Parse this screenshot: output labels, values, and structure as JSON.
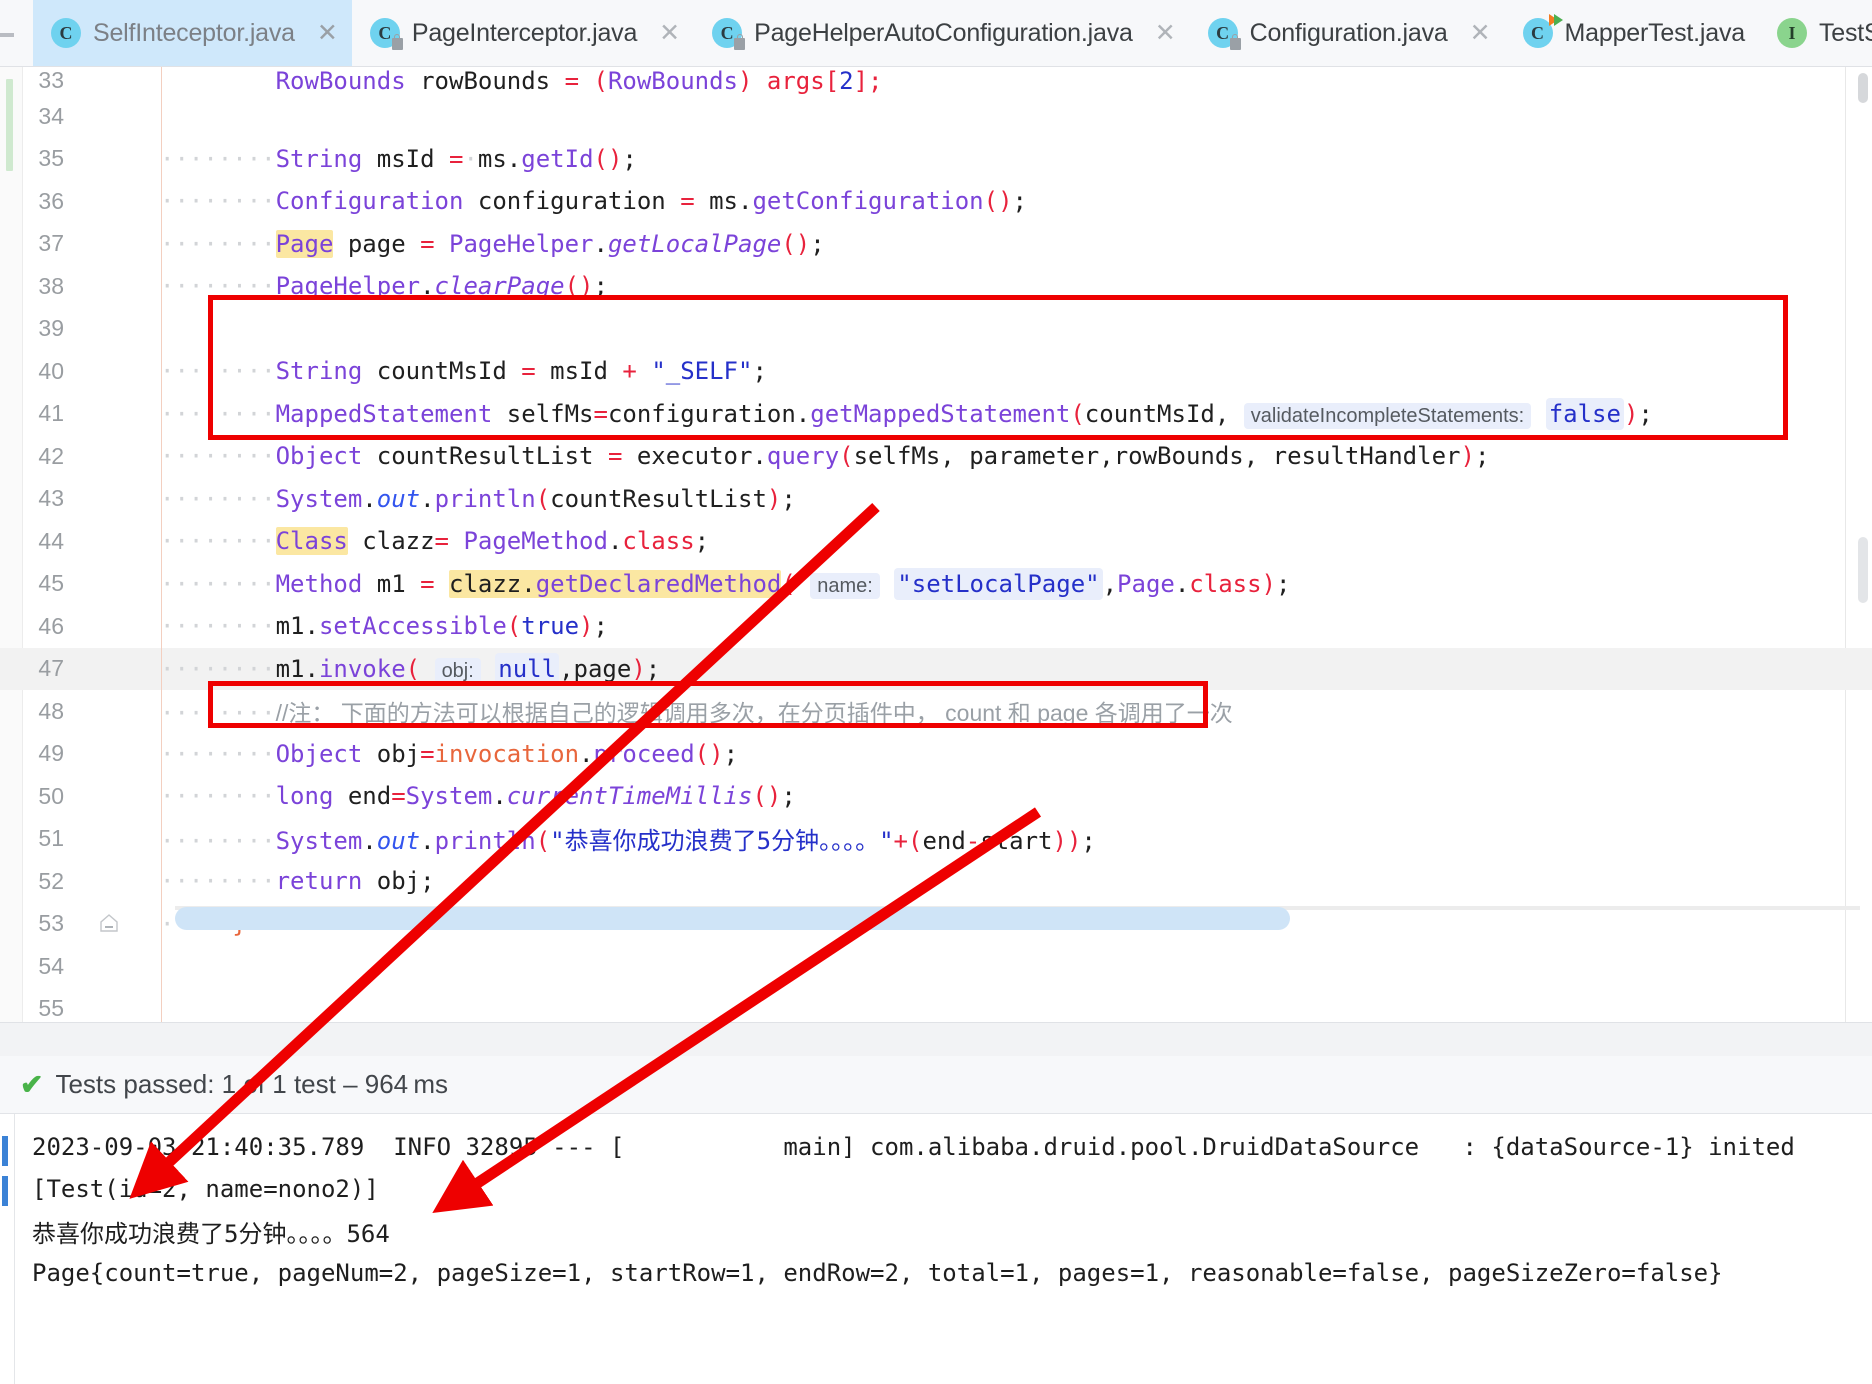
{
  "window": {
    "app": "IntelliJ IDEA Editor",
    "active_file": "SelfInteceptor.java"
  },
  "tabs": [
    {
      "label": "SelfInteceptor.java",
      "icon": "java-class-icon",
      "active": true,
      "closable": true,
      "badge": "none"
    },
    {
      "label": "PageInterceptor.java",
      "icon": "java-class-icon",
      "active": false,
      "closable": true,
      "badge": "lock"
    },
    {
      "label": "PageHelperAutoConfiguration.java",
      "icon": "java-class-icon",
      "active": false,
      "closable": true,
      "badge": "lock"
    },
    {
      "label": "Configuration.java",
      "icon": "java-class-icon",
      "active": false,
      "closable": true,
      "badge": "lock"
    },
    {
      "label": "MapperTest.java",
      "icon": "java-class-icon",
      "active": false,
      "closable": false,
      "badge": "runnable"
    },
    {
      "label": "TestService.java",
      "icon": "java-interface-icon",
      "active": false,
      "closable": true,
      "badge": "none"
    }
  ],
  "tab_close_glyph": "✕",
  "editor": {
    "first_visible_line": 33,
    "current_line": 47,
    "lines": [
      {
        "n": "33",
        "clipped": true,
        "tokens": [
          {
            "t": "        ",
            "c": "dots"
          },
          {
            "t": "RowBounds",
            "c": "type"
          },
          {
            "t": " rowBounds ",
            "c": "id"
          },
          {
            "t": "=",
            "c": "op"
          },
          {
            "t": " (",
            "c": "punct"
          },
          {
            "t": "RowBounds",
            "c": "type"
          },
          {
            "t": ") args[",
            "c": "punct"
          },
          {
            "t": "2",
            "c": "num"
          },
          {
            "t": "];",
            "c": "punct"
          }
        ]
      },
      {
        "n": "34",
        "tokens": []
      },
      {
        "n": "35",
        "tokens": [
          {
            "t": "········",
            "c": "dots"
          },
          {
            "t": "String",
            "c": "type"
          },
          {
            "t": " msId ",
            "c": "id"
          },
          {
            "t": "=",
            "c": "op"
          },
          {
            "t": "·",
            "c": "dots"
          },
          {
            "t": "ms.",
            "c": "id"
          },
          {
            "t": "getId",
            "c": "meth"
          },
          {
            "t": "()",
            "c": "punct"
          },
          {
            "t": ";",
            "c": "id"
          }
        ]
      },
      {
        "n": "36",
        "tokens": [
          {
            "t": "········",
            "c": "dots"
          },
          {
            "t": "Configuration",
            "c": "type"
          },
          {
            "t": " configuration ",
            "c": "id"
          },
          {
            "t": "=",
            "c": "op"
          },
          {
            "t": " ms.",
            "c": "id"
          },
          {
            "t": "getConfiguration",
            "c": "meth"
          },
          {
            "t": "()",
            "c": "punct"
          },
          {
            "t": ";",
            "c": "id"
          }
        ]
      },
      {
        "n": "37",
        "tokens": [
          {
            "t": "········",
            "c": "dots"
          },
          {
            "t": "Page",
            "c": "type hl-ident"
          },
          {
            "t": " page ",
            "c": "id"
          },
          {
            "t": "=",
            "c": "op"
          },
          {
            "t": " ",
            "c": "id"
          },
          {
            "t": "PageHelper",
            "c": "type"
          },
          {
            "t": ".",
            "c": "id"
          },
          {
            "t": "getLocalPage",
            "c": "meth italic"
          },
          {
            "t": "()",
            "c": "punct"
          },
          {
            "t": ";",
            "c": "id"
          }
        ]
      },
      {
        "n": "38",
        "tokens": [
          {
            "t": "········",
            "c": "dots"
          },
          {
            "t": "PageHelper",
            "c": "type"
          },
          {
            "t": ".",
            "c": "id"
          },
          {
            "t": "clearPage",
            "c": "meth italic"
          },
          {
            "t": "()",
            "c": "punct"
          },
          {
            "t": ";",
            "c": "id"
          }
        ]
      },
      {
        "n": "39",
        "tokens": []
      },
      {
        "n": "40",
        "boxed": true,
        "tokens": [
          {
            "t": "········",
            "c": "dots"
          },
          {
            "t": "String",
            "c": "type"
          },
          {
            "t": " countMsId ",
            "c": "id"
          },
          {
            "t": "=",
            "c": "op"
          },
          {
            "t": " msId ",
            "c": "id"
          },
          {
            "t": "+",
            "c": "op"
          },
          {
            "t": " ",
            "c": "id"
          },
          {
            "t": "\"_SELF\"",
            "c": "str"
          },
          {
            "t": ";",
            "c": "id"
          }
        ]
      },
      {
        "n": "41",
        "boxed": true,
        "tokens": [
          {
            "t": "········",
            "c": "dots"
          },
          {
            "t": "MappedStatement",
            "c": "type"
          },
          {
            "t": " selfMs",
            "c": "id"
          },
          {
            "t": "=",
            "c": "op"
          },
          {
            "t": "configuration.",
            "c": "id"
          },
          {
            "t": "getMappedStatement",
            "c": "meth"
          },
          {
            "t": "(",
            "c": "punct"
          },
          {
            "t": "countMsId,",
            "c": "id"
          },
          {
            "t": " ",
            "c": "dots"
          },
          {
            "t": "validateIncompleteStatements:",
            "c": "hintlabel"
          },
          {
            "t": " ",
            "c": "id"
          },
          {
            "t": "false",
            "c": "hintfalse"
          },
          {
            "t": ")",
            "c": "punct"
          },
          {
            "t": ";",
            "c": "id"
          }
        ]
      },
      {
        "n": "42",
        "boxed": true,
        "tokens": [
          {
            "t": "········",
            "c": "dots"
          },
          {
            "t": "Object",
            "c": "type"
          },
          {
            "t": " countResultList ",
            "c": "id"
          },
          {
            "t": "=",
            "c": "op"
          },
          {
            "t": " executor.",
            "c": "id"
          },
          {
            "t": "query",
            "c": "meth"
          },
          {
            "t": "(",
            "c": "punct"
          },
          {
            "t": "selfMs,",
            "c": "id"
          },
          {
            "t": " parameter,rowBounds,",
            "c": "id"
          },
          {
            "t": " resultHandler",
            "c": "id"
          },
          {
            "t": ")",
            "c": "punct"
          },
          {
            "t": ";",
            "c": "id"
          }
        ]
      },
      {
        "n": "43",
        "boxed": true,
        "tokens": [
          {
            "t": "········",
            "c": "dots"
          },
          {
            "t": "System",
            "c": "type"
          },
          {
            "t": ".",
            "c": "id"
          },
          {
            "t": "out",
            "c": "field"
          },
          {
            "t": ".",
            "c": "id"
          },
          {
            "t": "println",
            "c": "meth"
          },
          {
            "t": "(",
            "c": "punct"
          },
          {
            "t": "countResultList",
            "c": "id"
          },
          {
            "t": ")",
            "c": "punct"
          },
          {
            "t": ";",
            "c": "id"
          }
        ]
      },
      {
        "n": "44",
        "tokens": [
          {
            "t": "········",
            "c": "dots"
          },
          {
            "t": "Class",
            "c": "type hl-ident"
          },
          {
            "t": " clazz",
            "c": "id"
          },
          {
            "t": "=",
            "c": "op"
          },
          {
            "t": " ",
            "c": "id"
          },
          {
            "t": "PageMethod",
            "c": "type"
          },
          {
            "t": ".",
            "c": "id"
          },
          {
            "t": "class",
            "c": "op"
          },
          {
            "t": ";",
            "c": "id"
          }
        ]
      },
      {
        "n": "45",
        "tokens": [
          {
            "t": "········",
            "c": "dots"
          },
          {
            "t": "Method",
            "c": "type"
          },
          {
            "t": " m1 ",
            "c": "id"
          },
          {
            "t": "=",
            "c": "op"
          },
          {
            "t": " ",
            "c": "id"
          },
          {
            "t": "clazz.getDeclaredMethod",
            "c": "hl-method"
          },
          {
            "t": "(",
            "c": "punct"
          },
          {
            "t": " ",
            "c": "id"
          },
          {
            "t": "name:",
            "c": "hintlabel"
          },
          {
            "t": " ",
            "c": "id"
          },
          {
            "t": "\"setLocalPage\"",
            "c": "str hint-val"
          },
          {
            "t": ",",
            "c": "id"
          },
          {
            "t": "Page",
            "c": "type"
          },
          {
            "t": ".",
            "c": "id"
          },
          {
            "t": "class",
            "c": "op"
          },
          {
            "t": ")",
            "c": "punct"
          },
          {
            "t": ";",
            "c": "id"
          }
        ]
      },
      {
        "n": "46",
        "tokens": [
          {
            "t": "········",
            "c": "dots"
          },
          {
            "t": "m1.",
            "c": "id"
          },
          {
            "t": "setAccessible",
            "c": "meth"
          },
          {
            "t": "(",
            "c": "punct"
          },
          {
            "t": "true",
            "c": "str"
          },
          {
            "t": ")",
            "c": "punct"
          },
          {
            "t": ";",
            "c": "id"
          }
        ]
      },
      {
        "n": "47",
        "current": true,
        "tokens": [
          {
            "t": "········",
            "c": "dots"
          },
          {
            "t": "m1.",
            "c": "id"
          },
          {
            "t": "invoke",
            "c": "meth"
          },
          {
            "t": "(",
            "c": "punct"
          },
          {
            "t": " ",
            "c": "id"
          },
          {
            "t": "obj:",
            "c": "hintlabel"
          },
          {
            "t": " ",
            "c": "id"
          },
          {
            "t": "null",
            "c": "str hint-val"
          },
          {
            "t": ",page",
            "c": "id"
          },
          {
            "t": ")",
            "c": "punct"
          },
          {
            "t": ";",
            "c": "id"
          }
        ]
      },
      {
        "n": "48",
        "comment": "//注： 下面的方法可以根据自己的逻辑调用多次，在分页插件中， count 和 page 各调用了一次",
        "tokens": []
      },
      {
        "n": "49",
        "tokens": [
          {
            "t": "········",
            "c": "dots"
          },
          {
            "t": "Object",
            "c": "type"
          },
          {
            "t": " obj",
            "c": "id"
          },
          {
            "t": "=",
            "c": "op"
          },
          {
            "t": "invocation",
            "c": "orange"
          },
          {
            "t": ".",
            "c": "id"
          },
          {
            "t": "proceed",
            "c": "meth"
          },
          {
            "t": "()",
            "c": "punct"
          },
          {
            "t": ";",
            "c": "id"
          }
        ]
      },
      {
        "n": "50",
        "tokens": [
          {
            "t": "········",
            "c": "dots"
          },
          {
            "t": "long",
            "c": "type"
          },
          {
            "t": " end",
            "c": "id"
          },
          {
            "t": "=",
            "c": "op"
          },
          {
            "t": "System",
            "c": "type"
          },
          {
            "t": ".",
            "c": "id"
          },
          {
            "t": "currentTimeMillis",
            "c": "meth italic"
          },
          {
            "t": "()",
            "c": "punct"
          },
          {
            "t": ";",
            "c": "id"
          }
        ]
      },
      {
        "n": "51",
        "boxed2": true,
        "tokens": [
          {
            "t": "········",
            "c": "dots"
          },
          {
            "t": "System",
            "c": "type"
          },
          {
            "t": ".",
            "c": "id"
          },
          {
            "t": "out",
            "c": "field"
          },
          {
            "t": ".",
            "c": "id"
          },
          {
            "t": "println",
            "c": "meth"
          },
          {
            "t": "(",
            "c": "punct"
          },
          {
            "t": "\"恭喜你成功浪费了5分钟。。。。\"",
            "c": "str"
          },
          {
            "t": "+",
            "c": "op"
          },
          {
            "t": "(",
            "c": "punct"
          },
          {
            "t": "end",
            "c": "id"
          },
          {
            "t": "-",
            "c": "op"
          },
          {
            "t": "start",
            "c": "id"
          },
          {
            "t": "))",
            "c": "punct"
          },
          {
            "t": ";",
            "c": "id"
          }
        ]
      },
      {
        "n": "52",
        "tokens": [
          {
            "t": "········",
            "c": "dots"
          },
          {
            "t": "return",
            "c": "type"
          },
          {
            "t": " obj",
            "c": "id"
          },
          {
            "t": ";",
            "c": "id"
          }
        ]
      },
      {
        "n": "53",
        "fold": true,
        "tokens": [
          {
            "t": "·····",
            "c": "dots"
          },
          {
            "t": "}",
            "c": "brace"
          }
        ]
      },
      {
        "n": "54",
        "tokens": []
      },
      {
        "n": "55",
        "tokens": []
      }
    ]
  },
  "test_panel": {
    "status_icon": "check-icon",
    "status_text": "Tests passed: 1 of 1 test – 964 ms"
  },
  "console": {
    "lines": [
      "2023-09-03 21:40:35.789  INFO 32895 --- [           main] com.alibaba.druid.pool.DruidDataSource   : {dataSource-1} inited",
      "[Test(id=2, name=nono2)]",
      "恭喜你成功浪费了5分钟。。。。564",
      "Page{count=true, pageNum=2, pageSize=1, startRow=1, endRow=2, total=1, pages=1, reasonable=false, pageSizeZero=false}"
    ]
  },
  "annotations": {
    "box_color": "#ee0000",
    "boxes": [
      {
        "name": "count-query-block",
        "lines": "40-43"
      },
      {
        "name": "println-elapsed-line",
        "lines": "51"
      }
    ],
    "arrows": [
      {
        "name": "arrow-to-console-output-list",
        "from": "code-line-43",
        "to": "console-line-2"
      },
      {
        "name": "arrow-to-console-output-elapsed",
        "from": "code-line-51",
        "to": "console-line-3"
      }
    ]
  }
}
